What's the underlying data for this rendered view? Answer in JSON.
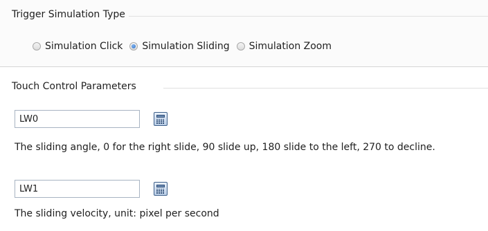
{
  "trigger_group": {
    "title": "Trigger Simulation Type",
    "options": [
      {
        "label": "Simulation Click",
        "checked": false
      },
      {
        "label": "Simulation Sliding",
        "checked": true
      },
      {
        "label": "Simulation Zoom",
        "checked": false
      }
    ]
  },
  "touch_group": {
    "title": "Touch Control Parameters",
    "angle_field": {
      "value": "LW0"
    },
    "angle_description": "The sliding angle, 0 for the right slide, 90 slide up, 180 slide to the left, 270 to decline.",
    "velocity_field": {
      "value": "LW1"
    },
    "velocity_description": "The sliding velocity, unit: pixel per second"
  },
  "icons": {
    "address_picker": "calculator-icon"
  },
  "colors": {
    "radio_selected": "#2f6fc9",
    "input_border": "#a7b3c2",
    "group_rule": "#e0e0e0"
  }
}
